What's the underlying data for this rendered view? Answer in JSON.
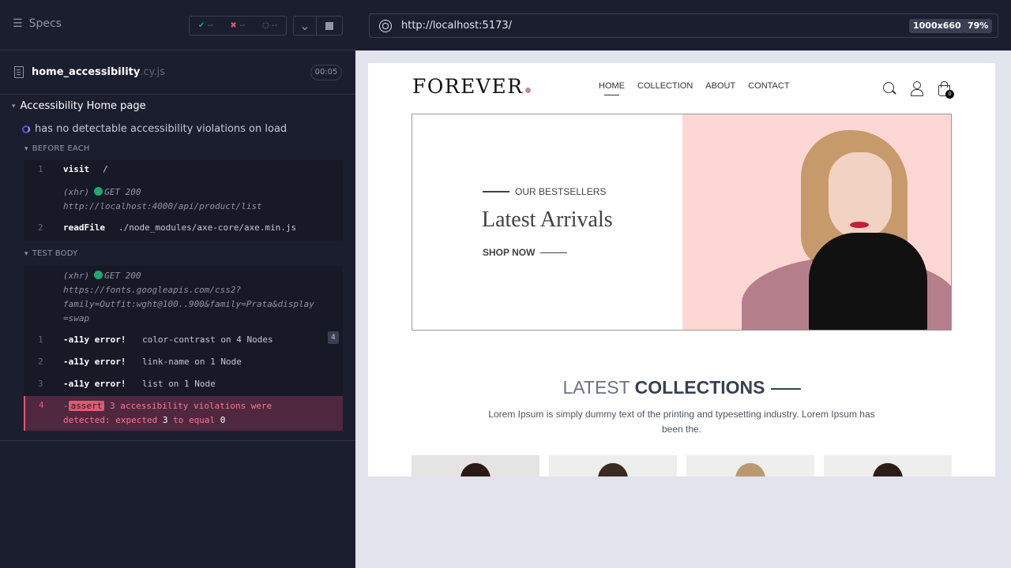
{
  "reporter": {
    "specs_label": "Specs",
    "stats": {
      "passed": "--",
      "failed": "--",
      "pending": "--"
    },
    "file": {
      "name": "home_accessibility",
      "ext": ".cy.js",
      "duration": "00:05"
    },
    "suite": "Accessibility Home page",
    "test": "has no detectable accessibility violations on load",
    "before_each": {
      "label": "BEFORE EACH",
      "commands": [
        {
          "num": "1",
          "name": "visit",
          "arg": "/"
        },
        {
          "xhr_label": "(xhr)",
          "xhr_status": "GET 200",
          "xhr_url": "http://localhost:4000/api/product/list"
        },
        {
          "num": "2",
          "name": "readFile",
          "arg": "./node_modules/axe-core/axe.min.js"
        }
      ]
    },
    "test_body": {
      "label": "TEST BODY",
      "xhr": {
        "label": "(xhr)",
        "status": "GET 200",
        "url_l1": "https://fonts.googleapis.com/css2?",
        "url_l2": "family=Outfit:wght@100..900&family=Prata&display",
        "url_l3": "=swap"
      },
      "commands": [
        {
          "num": "1",
          "name": "-a11y error!",
          "arg": "color-contrast on 4 Nodes",
          "badge": "4"
        },
        {
          "num": "2",
          "name": "-a11y error!",
          "arg": "link-name on 1 Node"
        },
        {
          "num": "3",
          "name": "-a11y error!",
          "arg": "list on 1 Node"
        }
      ],
      "error": {
        "num": "4",
        "prefix": "-",
        "tag": "assert",
        "msg1": "3 accessibility violations were",
        "msg2": "detected: expected",
        "expected": "3",
        "to_equal": "to equal",
        "actual": "0"
      }
    }
  },
  "browser": {
    "url": "http://localhost:5173/",
    "viewport": "1000x660",
    "zoom": "79%"
  },
  "site": {
    "logo": "FOREVER",
    "nav": [
      "HOME",
      "COLLECTION",
      "ABOUT",
      "CONTACT"
    ],
    "cart_count": "0",
    "hero": {
      "kicker": "OUR BESTSELLERS",
      "title": "Latest Arrivals",
      "cta": "SHOP NOW"
    },
    "collections": {
      "title_light": "LATEST",
      "title_bold": "COLLECTIONS",
      "desc": "Lorem Ipsum is simply dummy text of the printing and typesetting industry. Lorem Ipsum has been the."
    }
  },
  "colors": {
    "pass": "#1fa971",
    "fail": "#e45770",
    "accent": "#c586a5"
  }
}
